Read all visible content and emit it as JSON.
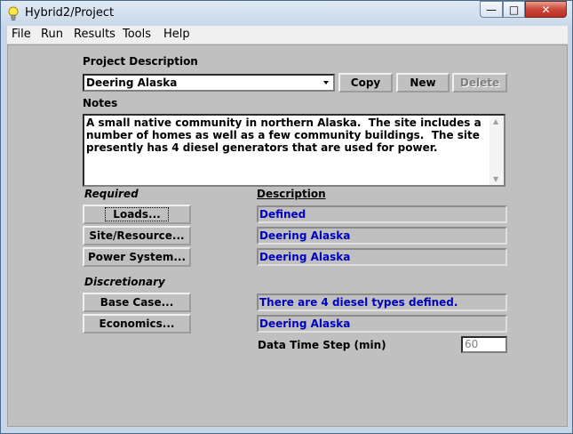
{
  "window": {
    "title": "Hybrid2/Project"
  },
  "caption_buttons": {
    "minimize": "—",
    "maximize": "□",
    "close": "✕"
  },
  "menu": {
    "items": [
      "File",
      "Run",
      "Results",
      "Tools",
      "Help"
    ]
  },
  "project": {
    "description_label": "Project Description",
    "selected": "Deering Alaska",
    "copy_label": "Copy",
    "new_label": "New",
    "delete_label": "Delete"
  },
  "notes": {
    "label": "Notes",
    "text": "A small native community in northern Alaska.  The site includes a number of homes as well as a few community buildings.  The site presently has 4 diesel generators that are used for power."
  },
  "required": {
    "heading": "Required",
    "description_heading": "Description",
    "rows": [
      {
        "button": "Loads...",
        "value": "Defined"
      },
      {
        "button": "Site/Resource...",
        "value": "Deering Alaska"
      },
      {
        "button": "Power System...",
        "value": "Deering Alaska"
      }
    ]
  },
  "discretionary": {
    "heading": "Discretionary",
    "rows": [
      {
        "button": "Base Case...",
        "value": "There are 4 diesel types defined."
      },
      {
        "button": "Economics...",
        "value": "Deering Alaska"
      }
    ]
  },
  "time_step": {
    "label": "Data Time Step (min)",
    "value": "60"
  }
}
